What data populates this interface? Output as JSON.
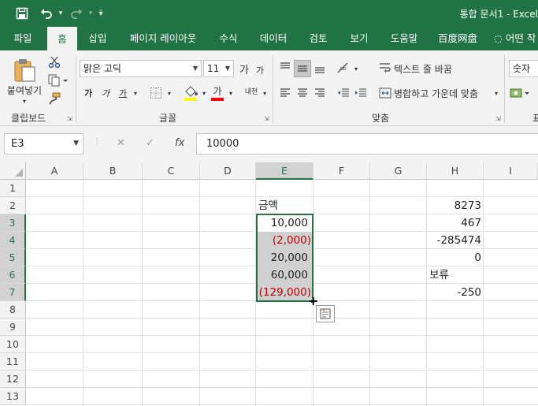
{
  "title_bar": {
    "title": "통합 문서1  -  Excel"
  },
  "tabs": [
    "파일",
    "홈",
    "삽입",
    "페이지 레이아웃",
    "수식",
    "데이터",
    "검토",
    "보기",
    "도움말",
    "百度网盘",
    "어떤 작"
  ],
  "ribbon": {
    "clipboard": {
      "paste_label": "붙여넣기",
      "group_label": "클립보드"
    },
    "font": {
      "font_name": "맑은 고딕",
      "font_size": "11",
      "grow": "가",
      "shrink": "가",
      "bold": "가",
      "italic": "가",
      "underline": "가",
      "font_color_letter": "가",
      "phonetic": "내천",
      "group_label": "글꼴"
    },
    "alignment": {
      "wrap_text": "텍스트 줄 바꿈",
      "merge_center": "병합하고 가운데 맞춤",
      "group_label": "맞춤"
    },
    "number": {
      "format": "숫자",
      "group_label_partial": "표"
    }
  },
  "formula_bar": {
    "name_box": "E3",
    "cancel": "✕",
    "enter": "✓",
    "fx": "fx",
    "content": "10000"
  },
  "columns": [
    "A",
    "B",
    "C",
    "D",
    "E",
    "F",
    "G",
    "H",
    "I"
  ],
  "rows": [
    "1",
    "2",
    "3",
    "4",
    "5",
    "6",
    "7",
    "8",
    "9",
    "10",
    "11",
    "12",
    "13"
  ],
  "cells": {
    "E2": "금액",
    "E3": "10,000",
    "E4": "(2,000)",
    "E5": "20,000",
    "E6": "60,000",
    "E7": "(129,000)",
    "H2": "8273",
    "H3": "467",
    "H4": "-285474",
    "H5": "0",
    "H6": "보류",
    "H7": "-250"
  },
  "colors": {
    "excel_green": "#217346",
    "negative_red": "#c00000",
    "font_color_bar": "#ff0000",
    "highlight_yellow": "#ffff00"
  }
}
